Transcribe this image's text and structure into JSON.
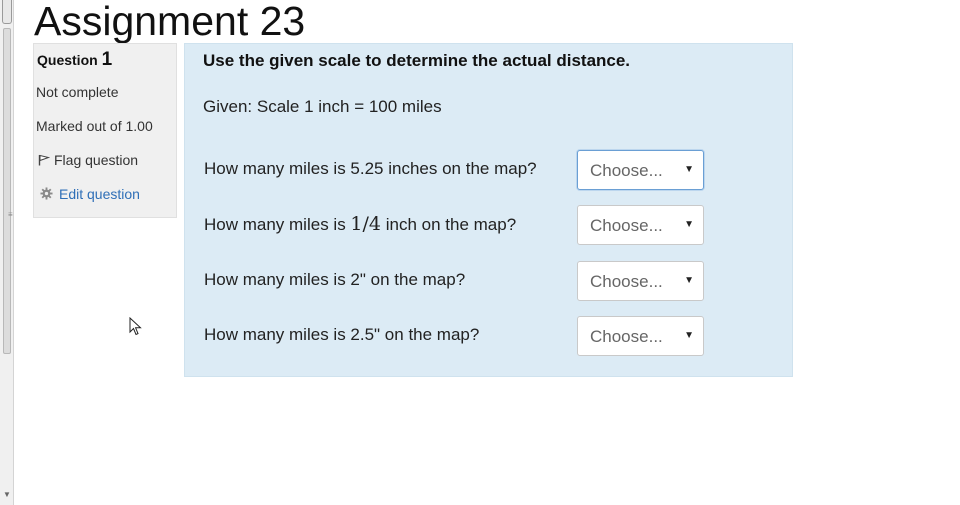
{
  "page": {
    "title": "Assignment 23"
  },
  "info": {
    "question_label": "Question",
    "question_number": "1",
    "state": "Not complete",
    "grade": "Marked out of 1.00",
    "flag_label": "Flag question",
    "edit_label": "Edit question"
  },
  "question": {
    "prompt": "Use the given scale to determine the actual distance.",
    "given": "Given: Scale 1 inch = 100 miles",
    "rows": [
      {
        "text": "How many miles is 5.25 inches on the map?",
        "selected": "Choose..."
      },
      {
        "text_before": "How many miles is ",
        "math": "1/4",
        "text_after": " inch on the map?",
        "selected": "Choose..."
      },
      {
        "text": "How many miles is 2\" on the map?",
        "selected": "Choose..."
      },
      {
        "text": "How many miles is 2.5\" on the map?",
        "selected": "Choose..."
      }
    ]
  },
  "colors": {
    "panel_bg": "#dcebf5",
    "info_bg": "#f0f0f0",
    "link": "#2f6fb7",
    "focus": "#6a9fd4"
  },
  "icons": [
    "flag-icon",
    "gear-icon",
    "dropdown-arrow-icon",
    "mouse-cursor-icon"
  ]
}
